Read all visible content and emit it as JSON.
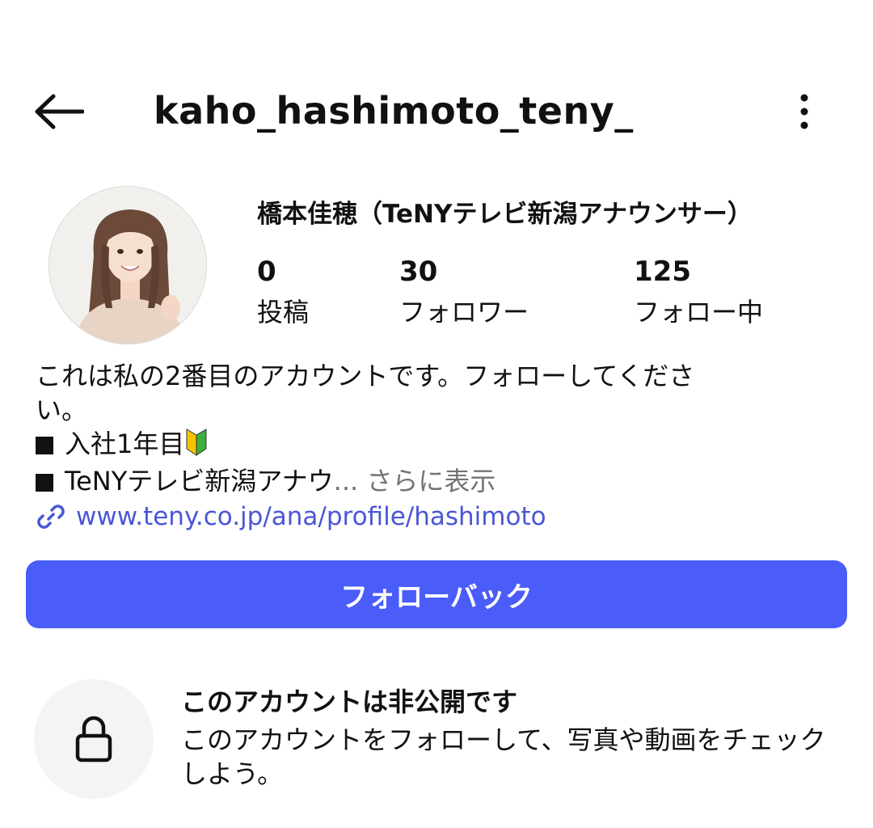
{
  "header": {
    "username": "kaho_hashimoto_teny_",
    "back_icon": "arrow-left-icon",
    "more_icon": "more-vertical-icon"
  },
  "profile": {
    "display_name": "橋本佳穂（TeNYテレビ新潟アナウンサー）",
    "stats": {
      "posts": {
        "value": "0",
        "label": "投稿"
      },
      "followers": {
        "value": "30",
        "label": "フォロワー"
      },
      "following": {
        "value": "125",
        "label": "フォロー中"
      }
    },
    "bio": {
      "line1": "これは私の2番目のアカウントです。フォローしてくださ",
      "line2": "い。",
      "line3": "入社1年目",
      "line4_text": "TeNYテレビ新潟アナウ",
      "ellipsis": "...",
      "more_label": "さらに表示",
      "emoji_icon": "japanese-beginner-mark-icon"
    },
    "link": {
      "text": "www.teny.co.jp/ana/profile/hashimoto",
      "icon": "link-icon"
    }
  },
  "actions": {
    "follow_back_label": "フォローバック"
  },
  "private_notice": {
    "title": "このアカウントは非公開です",
    "description": "このアカウントをフォローして、写真や動画をチェックしよう。",
    "icon": "lock-icon"
  },
  "colors": {
    "accent": "#4a5df9",
    "link": "#4a56d6",
    "muted": "#737373",
    "lock_bg": "#f3f4f5"
  }
}
